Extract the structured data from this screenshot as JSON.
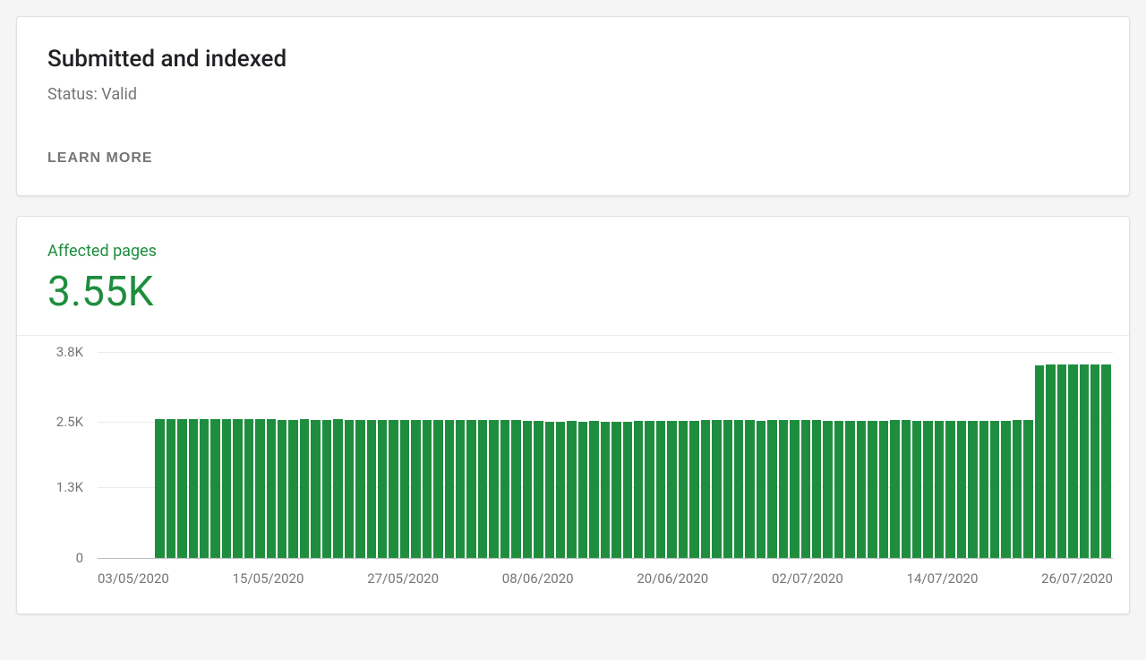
{
  "header": {
    "title": "Submitted and indexed",
    "status_prefix": "Status: ",
    "status_value": "Valid",
    "learn_more": "LEARN MORE"
  },
  "metric": {
    "label": "Affected pages",
    "value": "3.55K"
  },
  "chart_data": {
    "type": "bar",
    "title": "Affected pages",
    "xlabel": "",
    "ylabel": "",
    "ylim": [
      0,
      3800
    ],
    "y_ticks": [
      "0",
      "1.3K",
      "2.5K",
      "3.8K"
    ],
    "x_ticks": [
      "03/05/2020",
      "15/05/2020",
      "27/05/2020",
      "08/06/2020",
      "20/06/2020",
      "02/07/2020",
      "14/07/2020",
      "26/07/2020"
    ],
    "categories": [
      "03/05/2020",
      "04/05/2020",
      "05/05/2020",
      "06/05/2020",
      "07/05/2020",
      "08/05/2020",
      "09/05/2020",
      "10/05/2020",
      "11/05/2020",
      "12/05/2020",
      "13/05/2020",
      "14/05/2020",
      "15/05/2020",
      "16/05/2020",
      "17/05/2020",
      "18/05/2020",
      "19/05/2020",
      "20/05/2020",
      "21/05/2020",
      "22/05/2020",
      "23/05/2020",
      "24/05/2020",
      "25/05/2020",
      "26/05/2020",
      "27/05/2020",
      "28/05/2020",
      "29/05/2020",
      "30/05/2020",
      "31/05/2020",
      "01/06/2020",
      "02/06/2020",
      "03/06/2020",
      "04/06/2020",
      "05/06/2020",
      "06/06/2020",
      "07/06/2020",
      "08/06/2020",
      "09/06/2020",
      "10/06/2020",
      "11/06/2020",
      "12/06/2020",
      "13/06/2020",
      "14/06/2020",
      "15/06/2020",
      "16/06/2020",
      "17/06/2020",
      "18/06/2020",
      "19/06/2020",
      "20/06/2020",
      "21/06/2020",
      "22/06/2020",
      "23/06/2020",
      "24/06/2020",
      "25/06/2020",
      "26/06/2020",
      "27/06/2020",
      "28/06/2020",
      "29/06/2020",
      "30/06/2020",
      "01/07/2020",
      "02/07/2020",
      "03/07/2020",
      "04/07/2020",
      "05/07/2020",
      "06/07/2020",
      "07/07/2020",
      "08/07/2020",
      "09/07/2020",
      "10/07/2020",
      "11/07/2020",
      "12/07/2020",
      "13/07/2020",
      "14/07/2020",
      "15/07/2020",
      "16/07/2020",
      "17/07/2020",
      "18/07/2020",
      "19/07/2020",
      "20/07/2020",
      "21/07/2020",
      "22/07/2020",
      "23/07/2020",
      "24/07/2020",
      "25/07/2020",
      "26/07/2020",
      "27/07/2020",
      "28/07/2020",
      "29/07/2020",
      "30/07/2020",
      "31/07/2020",
      "01/08/2020"
    ],
    "values": [
      0,
      0,
      0,
      0,
      0,
      2550,
      2550,
      2550,
      2550,
      2550,
      2550,
      2550,
      2550,
      2550,
      2550,
      2550,
      2540,
      2540,
      2550,
      2540,
      2540,
      2550,
      2540,
      2540,
      2540,
      2540,
      2540,
      2540,
      2540,
      2540,
      2540,
      2540,
      2530,
      2530,
      2530,
      2530,
      2530,
      2530,
      2520,
      2520,
      2510,
      2510,
      2520,
      2510,
      2520,
      2510,
      2510,
      2510,
      2520,
      2520,
      2520,
      2520,
      2520,
      2520,
      2530,
      2530,
      2530,
      2530,
      2530,
      2520,
      2530,
      2530,
      2530,
      2540,
      2530,
      2520,
      2520,
      2520,
      2520,
      2520,
      2520,
      2530,
      2530,
      2520,
      2520,
      2520,
      2520,
      2520,
      2520,
      2520,
      2520,
      2520,
      2530,
      2540,
      3550,
      3560,
      3560,
      3560,
      3560,
      3570,
      3570
    ]
  },
  "colors": {
    "accent": "#1e8e3e"
  }
}
